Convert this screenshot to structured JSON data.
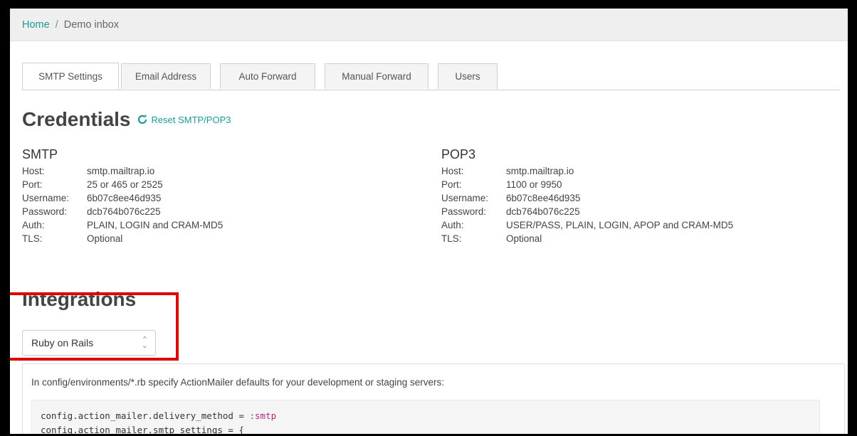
{
  "breadcrumb": {
    "home": "Home",
    "separator": "/",
    "current": "Demo inbox"
  },
  "tabs": [
    {
      "label": "SMTP Settings",
      "active": true
    },
    {
      "label": "Email Address",
      "active": false
    },
    {
      "label": "Auto Forward",
      "active": false
    },
    {
      "label": "Manual Forward",
      "active": false
    },
    {
      "label": "Users",
      "active": false
    }
  ],
  "credentials": {
    "title": "Credentials",
    "reset_label": "Reset SMTP/POP3",
    "smtp": {
      "title": "SMTP",
      "rows": [
        {
          "k": "Host:",
          "v": "smtp.mailtrap.io"
        },
        {
          "k": "Port:",
          "v": "25 or 465 or 2525"
        },
        {
          "k": "Username:",
          "v": "6b07c8ee46d935"
        },
        {
          "k": "Password:",
          "v": "dcb764b076c225"
        },
        {
          "k": "Auth:",
          "v": "PLAIN, LOGIN and CRAM-MD5"
        },
        {
          "k": "TLS:",
          "v": "Optional"
        }
      ]
    },
    "pop3": {
      "title": "POP3",
      "rows": [
        {
          "k": "Host:",
          "v": "smtp.mailtrap.io"
        },
        {
          "k": "Port:",
          "v": "1100 or 9950"
        },
        {
          "k": "Username:",
          "v": "6b07c8ee46d935"
        },
        {
          "k": "Password:",
          "v": "dcb764b076c225"
        },
        {
          "k": "Auth:",
          "v": "USER/PASS, PLAIN, LOGIN, APOP and CRAM-MD5"
        },
        {
          "k": "TLS:",
          "v": "Optional"
        }
      ]
    }
  },
  "integrations": {
    "title": "Integrations",
    "selected": "Ruby on Rails",
    "description": "In config/environments/*.rb specify ActionMailer defaults for your development or staging servers:",
    "code_line1_prefix": "config.action_mailer.delivery_method = ",
    "code_line1_symbol": ":smtp",
    "code_line2": "config.action_mailer.smtp_settings = {"
  },
  "colors": {
    "accent": "#1b9a95",
    "highlight": "#e00000",
    "symbol": "#b0287a"
  }
}
